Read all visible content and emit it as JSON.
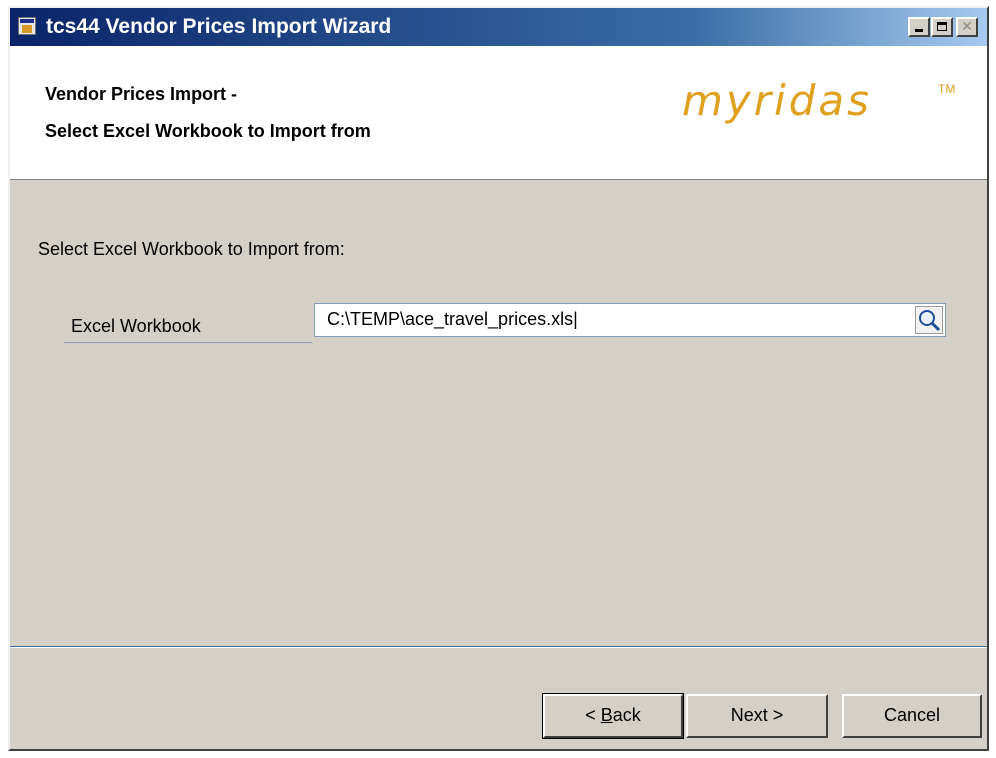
{
  "window": {
    "title": "tcs44 Vendor Prices Import Wizard",
    "controls": [
      "minimize",
      "maximize",
      "close"
    ]
  },
  "header": {
    "line1": "Vendor Prices Import -",
    "line2": "Select Excel Workbook to Import from",
    "logo_text": "myridas",
    "logo_tm": "TM",
    "logo_color": "#e0a020"
  },
  "body": {
    "section_label": "Select Excel Workbook to Import from:",
    "field_label": "Excel Workbook",
    "workbook_path": "C:\\TEMP\\ace_travel_prices.xls|"
  },
  "icons": {
    "browse": "magnifier-icon",
    "app": "window-app-icon"
  },
  "buttons": {
    "back_prefix": "< ",
    "back_accel": "B",
    "back_rest": "ack",
    "next": "Next >",
    "cancel": "Cancel"
  },
  "colors": {
    "titlebar_start": "#0a246a",
    "titlebar_end": "#a6caf0",
    "dialog_bg": "#d4d0c8"
  }
}
